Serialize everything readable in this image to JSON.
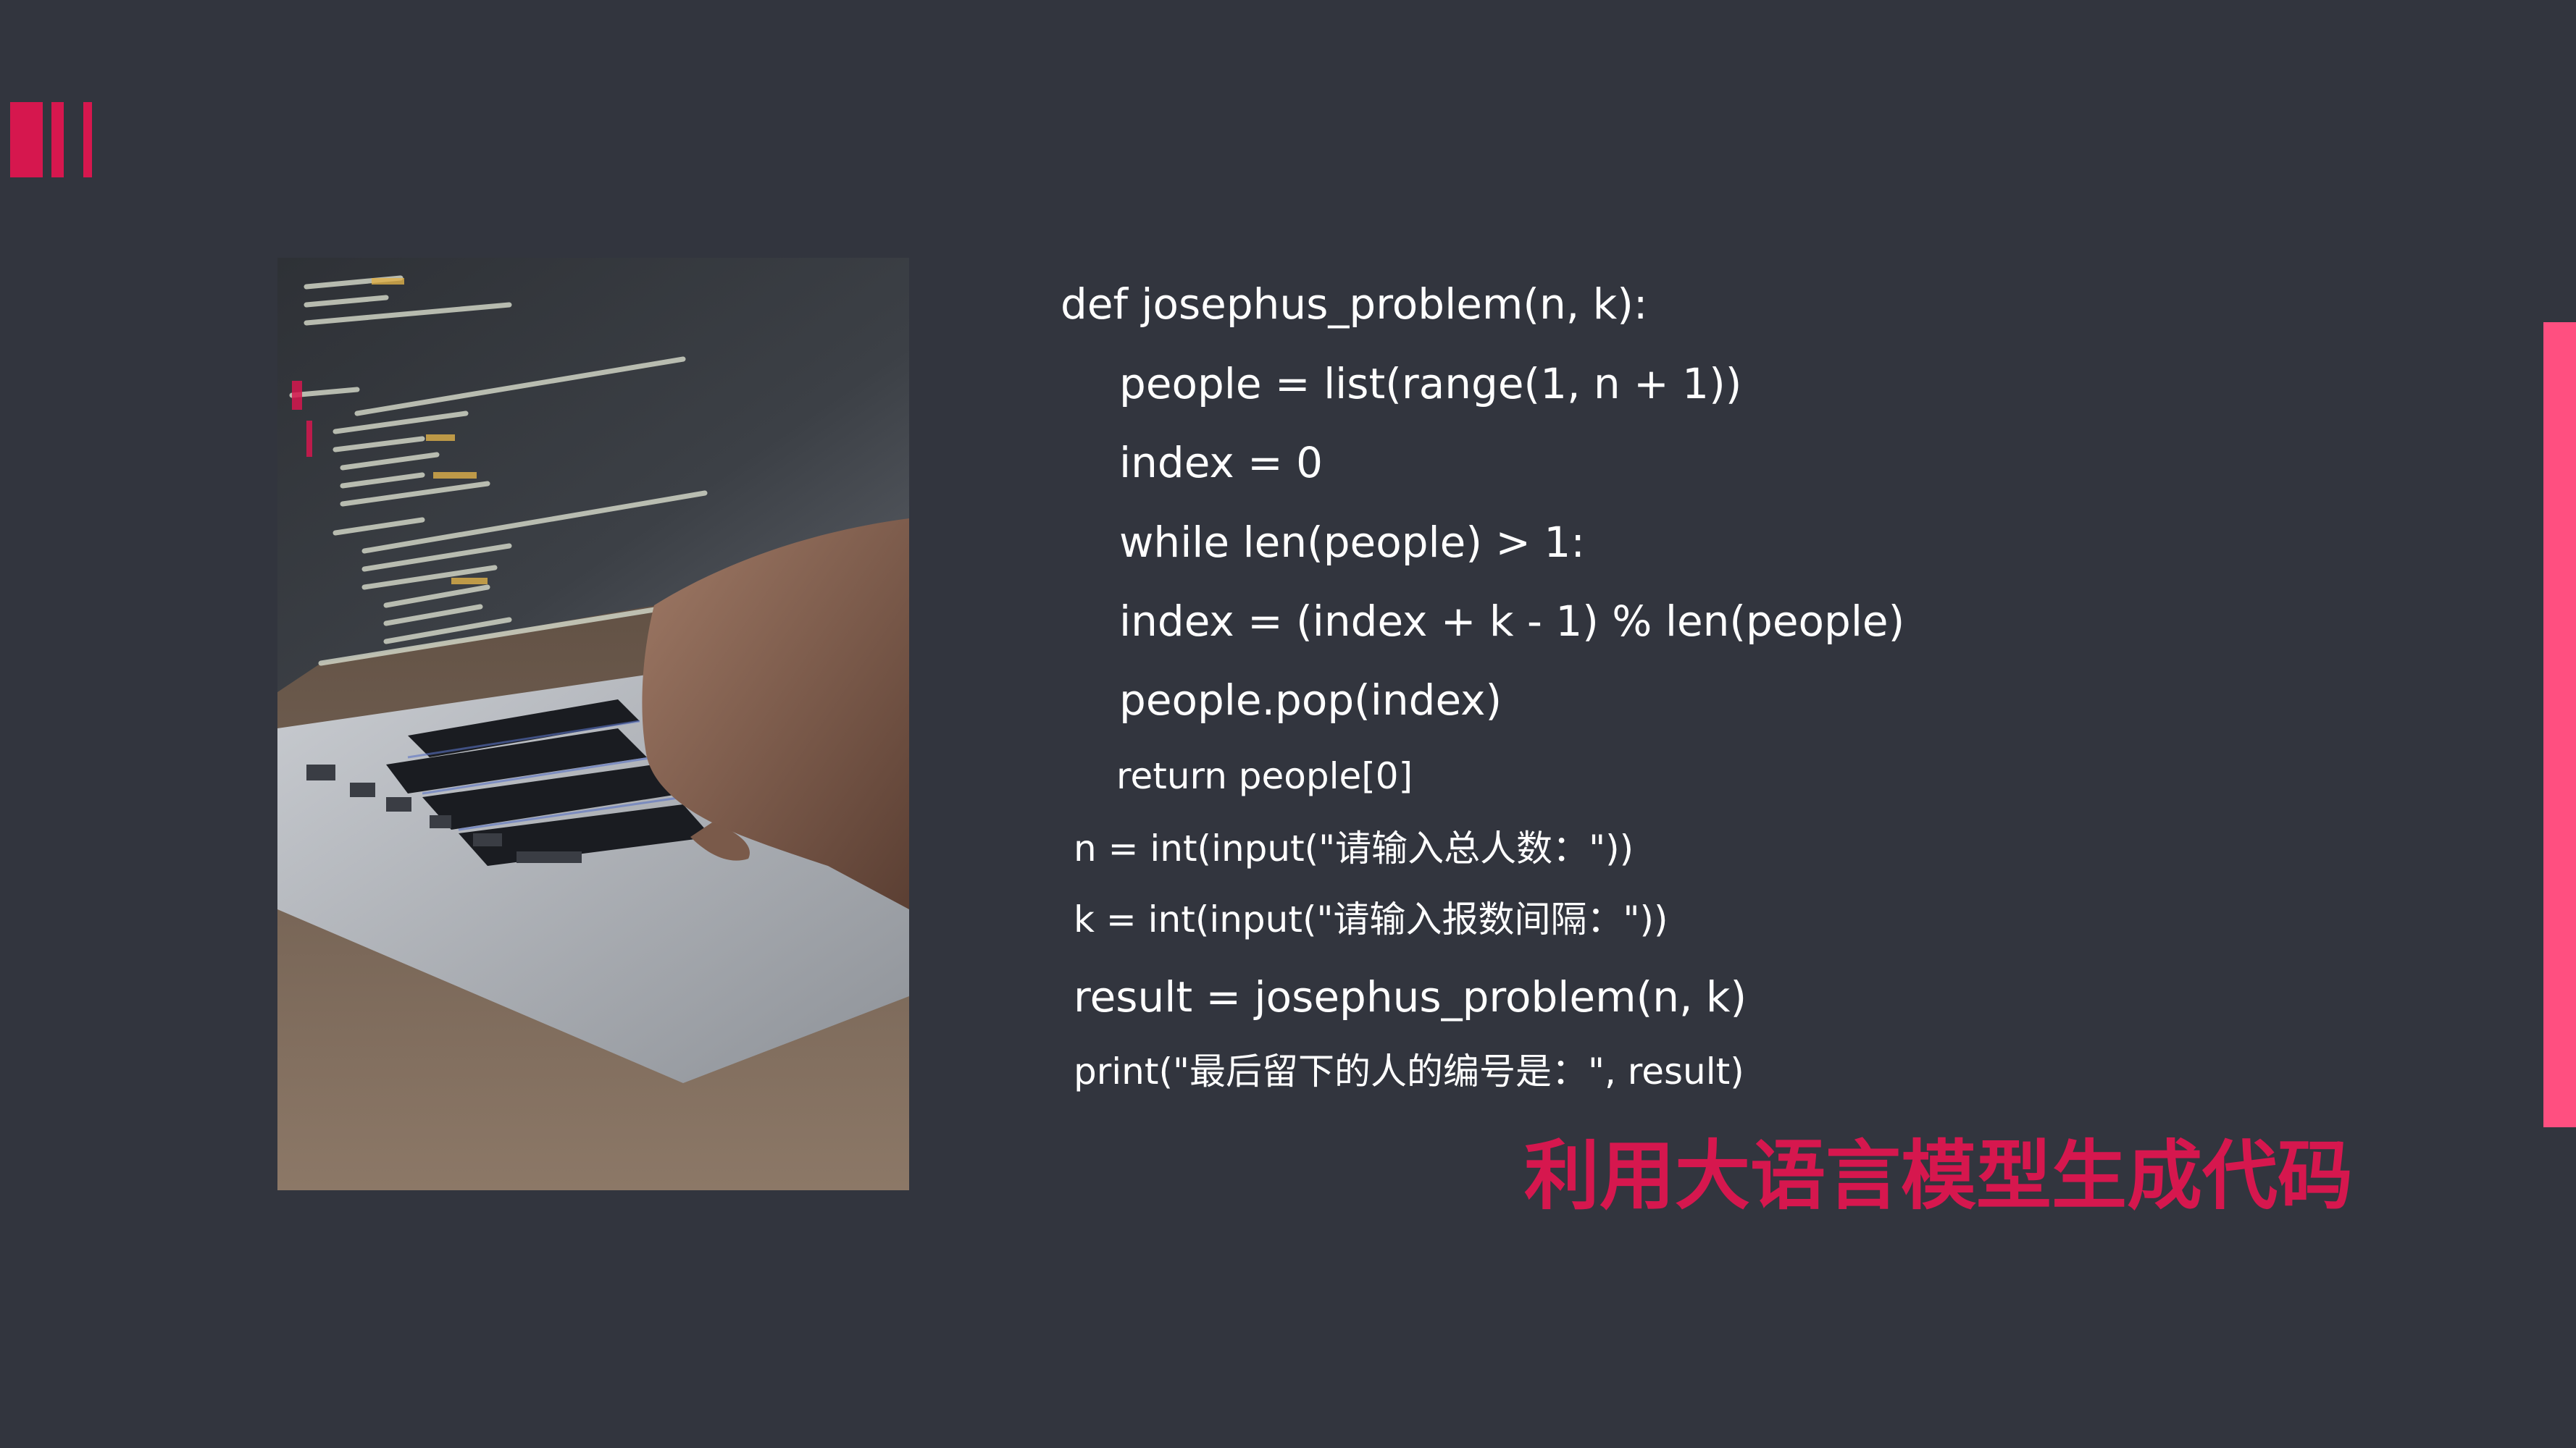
{
  "code": {
    "lines": [
      "def josephus_problem(n, k):",
      "people = list(range(1, n + 1))",
      "index = 0",
      "while len(people) > 1:",
      "index = (index + k - 1) % len(people)",
      "people.pop(index)",
      "return people[0]",
      "n = int(input(\"请输入总人数：\"))",
      "k = int(input(\"请输入报数间隔：\"))",
      "result = josephus_problem(n, k)",
      "print(\"最后留下的人的编号是：\", result)"
    ]
  },
  "headline": "利用大语言模型生成代码",
  "colors": {
    "background": "#32353e",
    "accent": "#d6174e",
    "side_bar": "#ff4f80",
    "code_text": "#ffffff"
  }
}
